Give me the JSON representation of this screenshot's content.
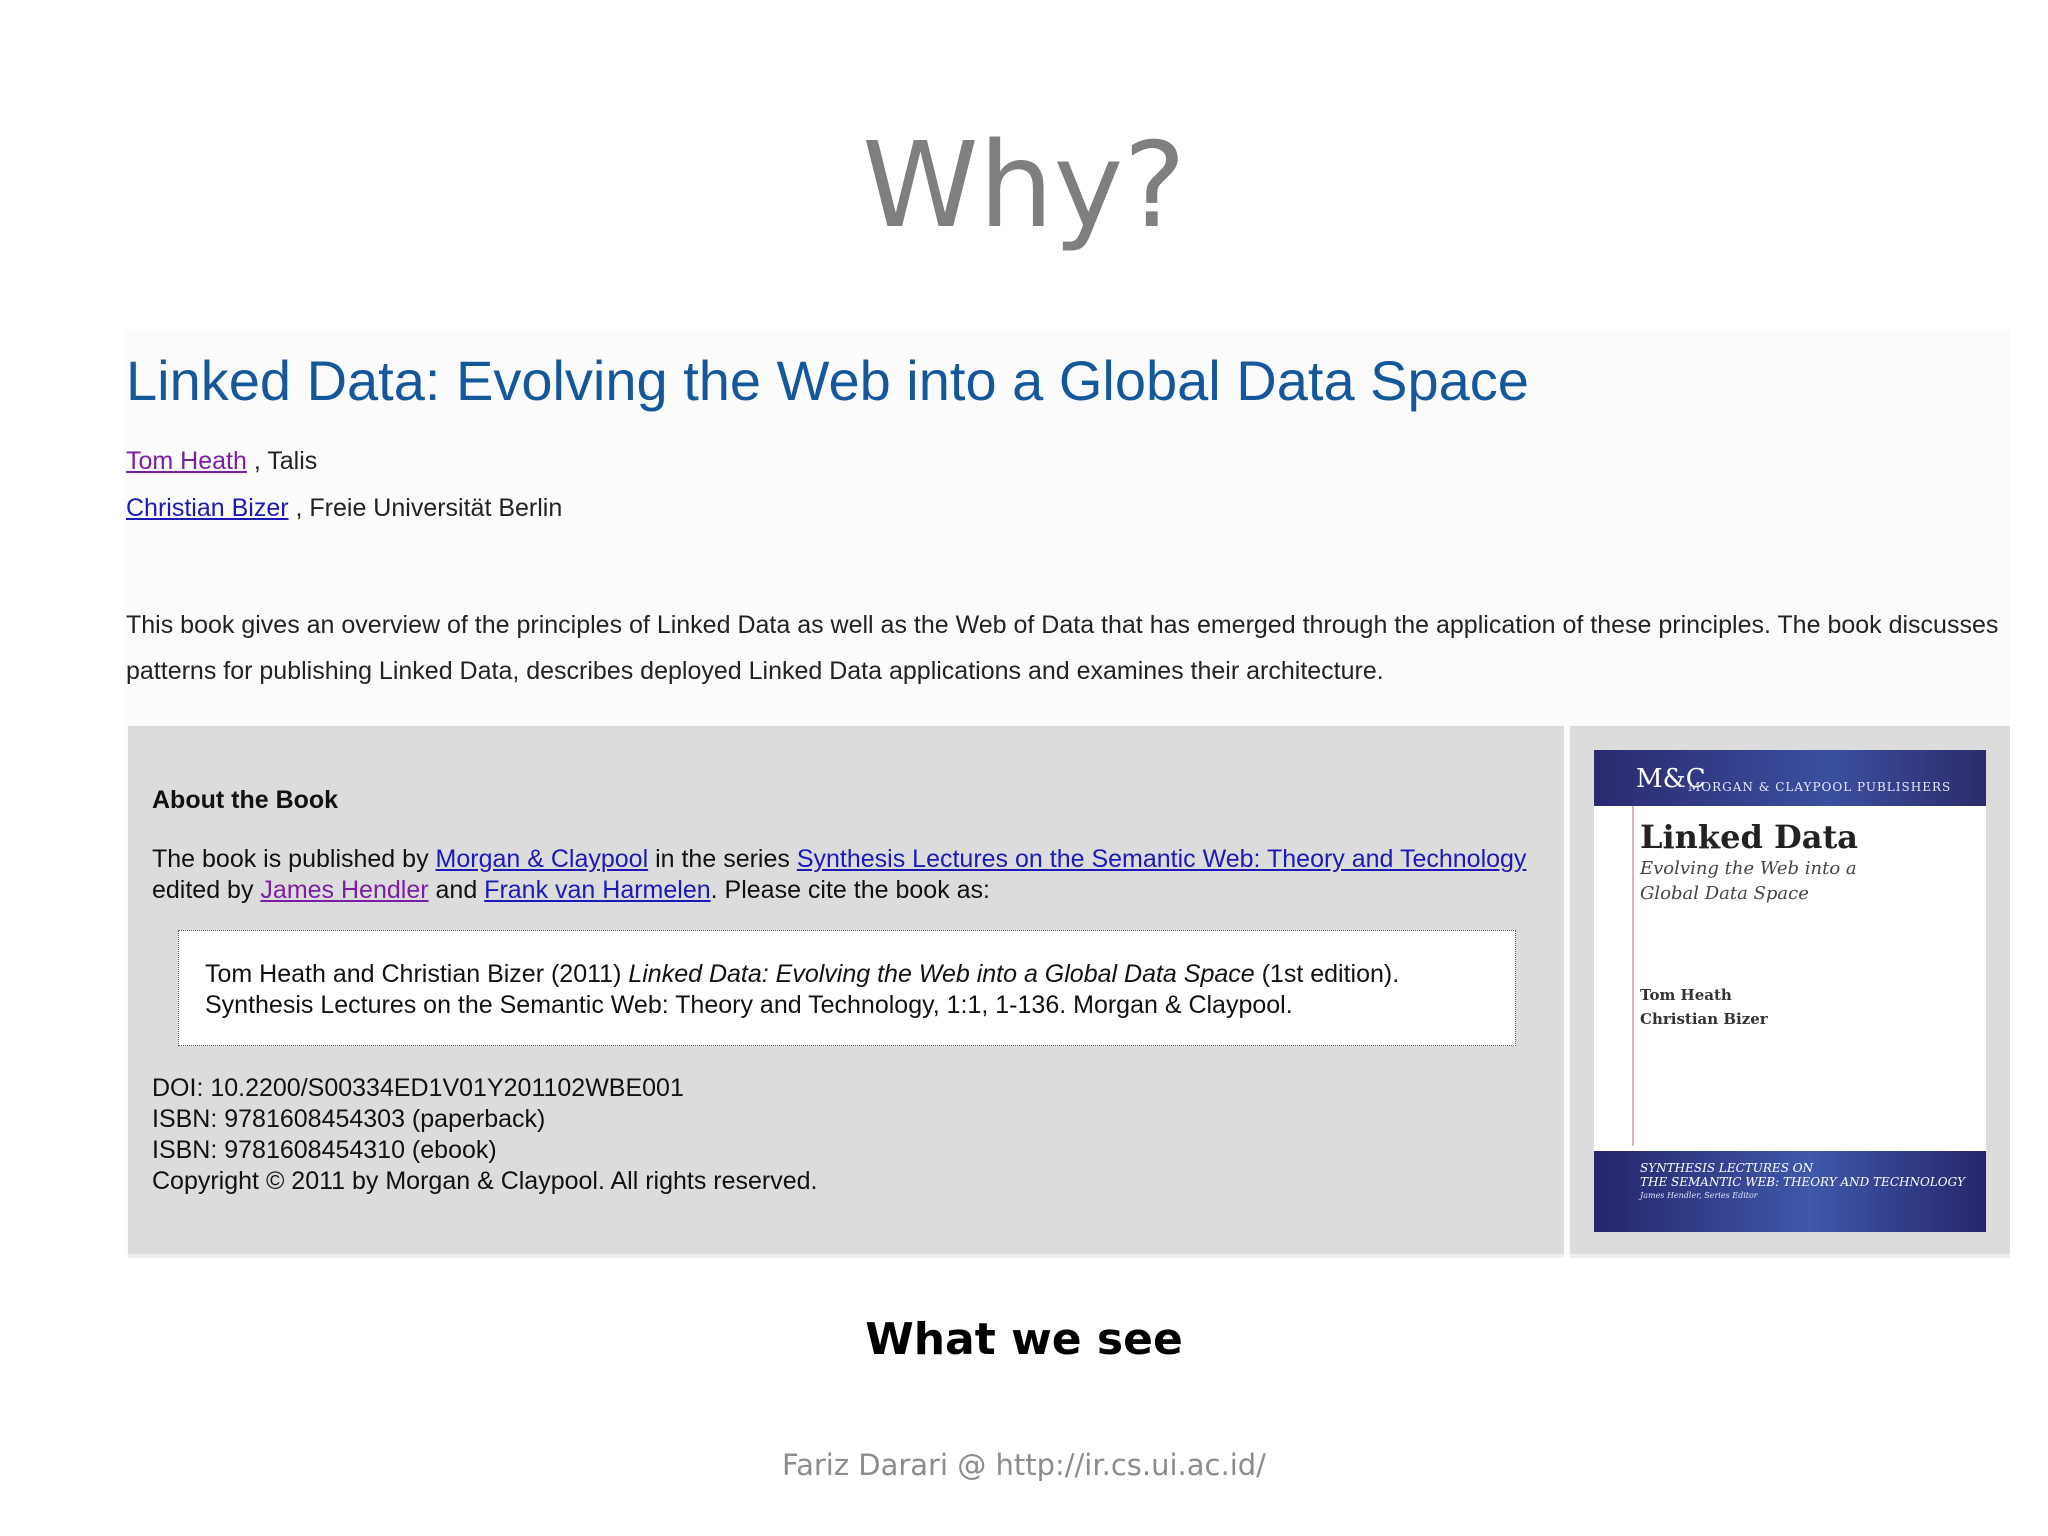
{
  "slide": {
    "title": "Why?",
    "caption": "What we see",
    "footer": "Fariz Darari @ http://ir.cs.ui.ac.id/"
  },
  "page": {
    "book_title": "Linked Data: Evolving the Web into a Global Data Space",
    "authors": [
      {
        "name": "Tom Heath",
        "affiliation": " , Talis"
      },
      {
        "name": "Christian Bizer",
        "affiliation": " , Freie Universität Berlin"
      }
    ],
    "summary": "This book gives an overview of the principles of Linked Data as well as the Web of Data that has emerged through the application of these principles. The book discusses patterns for publishing Linked Data, describes deployed Linked Data applications and examines their architecture.",
    "about": {
      "heading": "About the Book",
      "text_1": "The book is published by ",
      "link_publisher": "Morgan & Claypool",
      "text_2": " in the series ",
      "link_series": "Synthesis Lectures on the Semantic Web: Theory and Technology",
      "text_3": " edited by ",
      "link_editor_1": "James Hendler",
      "text_4": " and ",
      "link_editor_2": "Frank van Harmelen",
      "text_5": ". Please cite the book as:"
    },
    "citation": {
      "prefix": "Tom Heath and Christian Bizer (2011) ",
      "title_italic": "Linked Data: Evolving the Web into a Global Data Space",
      "suffix": " (1st edition).",
      "line_2": "Synthesis Lectures on the Semantic Web: Theory and Technology, 1:1, 1-136. Morgan & Claypool."
    },
    "meta": {
      "doi": "DOI: 10.2200/S00334ED1V01Y201102WBE001",
      "isbn_paperback": "ISBN: 9781608454303 (paperback)",
      "isbn_ebook": "ISBN: 9781608454310 (ebook)",
      "copyright": "Copyright © 2011 by Morgan & Claypool. All rights reserved."
    },
    "cover": {
      "logo": "M&C",
      "publisher": "MORGAN & CLAYPOOL PUBLISHERS",
      "title": "Linked Data",
      "subtitle": "Evolving the Web into a Global Data Space",
      "author_1": "Tom Heath",
      "author_2": "Christian Bizer",
      "series_1": "SYNTHESIS LECTURES ON",
      "series_2": "THE SEMANTIC WEB: THEORY AND TECHNOLOGY",
      "series_3": "James Hendler, Series Editor"
    }
  },
  "colors": {
    "title_gray": "#7f7f7f",
    "book_title_blue": "#14589b",
    "link_blue": "#1a1ab5",
    "link_visited": "#7b1fa2",
    "panel_gray": "#dcdcdc",
    "cover_navy": "#2a2a6e"
  }
}
